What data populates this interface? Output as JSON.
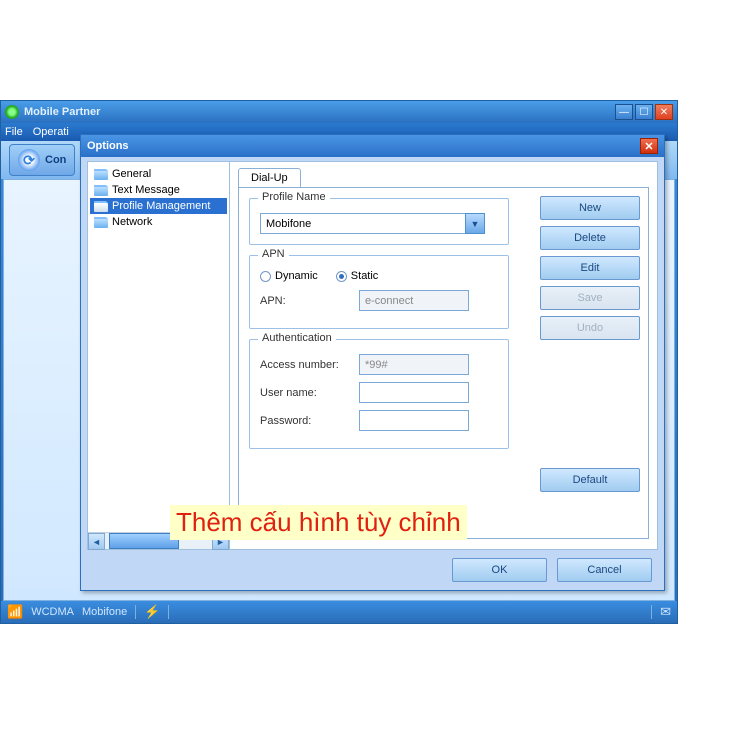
{
  "main": {
    "title": "Mobile Partner",
    "menu": {
      "file": "File",
      "operations": "Operati"
    },
    "toolbar": {
      "connection": "Con"
    },
    "status": {
      "network": "WCDMA",
      "profile": "Mobifone"
    }
  },
  "dialog": {
    "title": "Options",
    "tree": {
      "items": [
        {
          "label": "General"
        },
        {
          "label": "Text Message"
        },
        {
          "label": "Profile Management"
        },
        {
          "label": "Network"
        }
      ]
    },
    "tab": {
      "label": "Dial-Up"
    },
    "profile": {
      "group_title": "Profile Name",
      "value": "Mobifone"
    },
    "apn": {
      "group_title": "APN",
      "dynamic_label": "Dynamic",
      "static_label": "Static",
      "apn_label": "APN:",
      "apn_value": "e-connect"
    },
    "auth": {
      "group_title": "Authentication",
      "access_label": "Access number:",
      "access_value": "*99#",
      "user_label": "User name:",
      "user_value": "",
      "pass_label": "Password:",
      "pass_value": ""
    },
    "buttons": {
      "new": "New",
      "delete": "Delete",
      "edit": "Edit",
      "save": "Save",
      "undo": "Undo",
      "default": "Default",
      "ok": "OK",
      "cancel": "Cancel"
    }
  },
  "annotation": "Thêm cấu hình tùy chỉnh"
}
